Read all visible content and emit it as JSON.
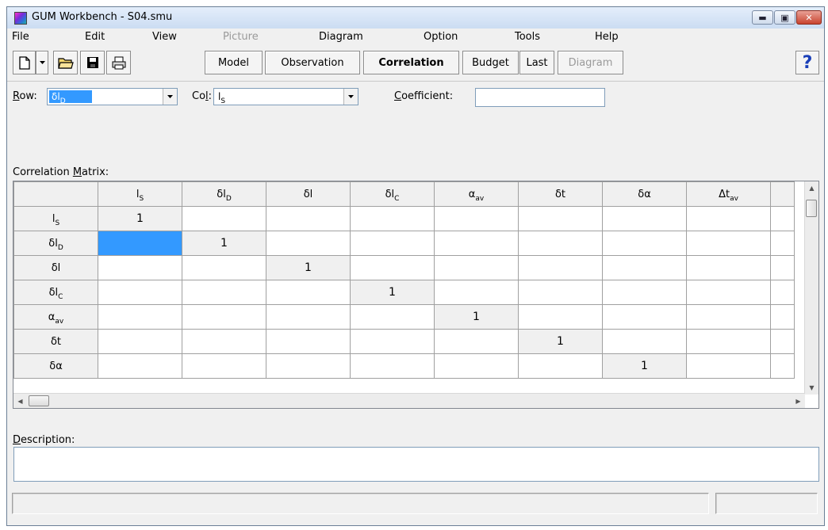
{
  "window": {
    "title": "GUM Workbench - S04.smu",
    "min_glyph": "▬",
    "max_glyph": "▣",
    "close_glyph": "✕"
  },
  "menu": [
    {
      "label": "File"
    },
    {
      "label": "Edit"
    },
    {
      "label": "View"
    },
    {
      "label": "Picture",
      "disabled": true
    },
    {
      "label": "Diagram"
    },
    {
      "label": "Option"
    },
    {
      "label": "Tools"
    },
    {
      "label": "Help"
    }
  ],
  "toolbar": {
    "icons": [
      "new-file-icon",
      "dropdown-arrow-icon",
      "open-folder-icon",
      "save-disk-icon",
      "print-icon",
      "help-icon"
    ],
    "buttons": [
      {
        "label": "Model"
      },
      {
        "label": "Observation"
      },
      {
        "label": "Correlation",
        "active": true
      },
      {
        "label": "Budget"
      },
      {
        "label": "Last"
      },
      {
        "label": "Diagram",
        "disabled": true
      }
    ],
    "help_glyph": "?"
  },
  "selectors": {
    "row_label_pre": "R",
    "row_label_post": "ow:",
    "row_value_main": "δl",
    "row_value_sub": "D",
    "col_label_pre": "Co",
    "col_label_mid": "l",
    "col_label_post": ":",
    "col_value_main": "l",
    "col_value_sub": "S",
    "coefficient_label_pre": "C",
    "coefficient_label_post": "oefficient:",
    "coefficient_value": ""
  },
  "matrix": {
    "label_pre": "Correlation ",
    "label_u": "M",
    "label_post": "atrix:",
    "columns": [
      {
        "main": "l",
        "sub": "S"
      },
      {
        "main": "δl",
        "sub": "D"
      },
      {
        "main": "δl",
        "sub": ""
      },
      {
        "main": "δl",
        "sub": "C"
      },
      {
        "main": "α",
        "sub": "av"
      },
      {
        "main": "δt",
        "sub": ""
      },
      {
        "main": "δα",
        "sub": ""
      },
      {
        "main": "Δt",
        "sub": "av"
      }
    ],
    "rows": [
      {
        "main": "l",
        "sub": "S",
        "cells": [
          "1",
          "",
          "",
          "",
          "",
          "",
          "",
          ""
        ]
      },
      {
        "main": "δl",
        "sub": "D",
        "cells": [
          "",
          "1",
          "",
          "",
          "",
          "",
          "",
          ""
        ]
      },
      {
        "main": "δl",
        "sub": "",
        "cells": [
          "",
          "",
          "1",
          "",
          "",
          "",
          "",
          ""
        ]
      },
      {
        "main": "δl",
        "sub": "C",
        "cells": [
          "",
          "",
          "",
          "1",
          "",
          "",
          "",
          ""
        ]
      },
      {
        "main": "α",
        "sub": "av",
        "cells": [
          "",
          "",
          "",
          "",
          "1",
          "",
          "",
          ""
        ]
      },
      {
        "main": "δt",
        "sub": "",
        "cells": [
          "",
          "",
          "",
          "",
          "",
          "1",
          "",
          ""
        ]
      },
      {
        "main": "δα",
        "sub": "",
        "cells": [
          "",
          "",
          "",
          "",
          "",
          "",
          "1",
          ""
        ]
      }
    ],
    "selected_cell": {
      "row": 1,
      "col": 0
    }
  },
  "description": {
    "label_u": "D",
    "label_post": "escription:",
    "value": ""
  },
  "status": {
    "left": "",
    "right": ""
  },
  "colors": {
    "selection": "#3399ff",
    "header_bg": "#f0f0f0",
    "close_red": "#c9442f"
  }
}
